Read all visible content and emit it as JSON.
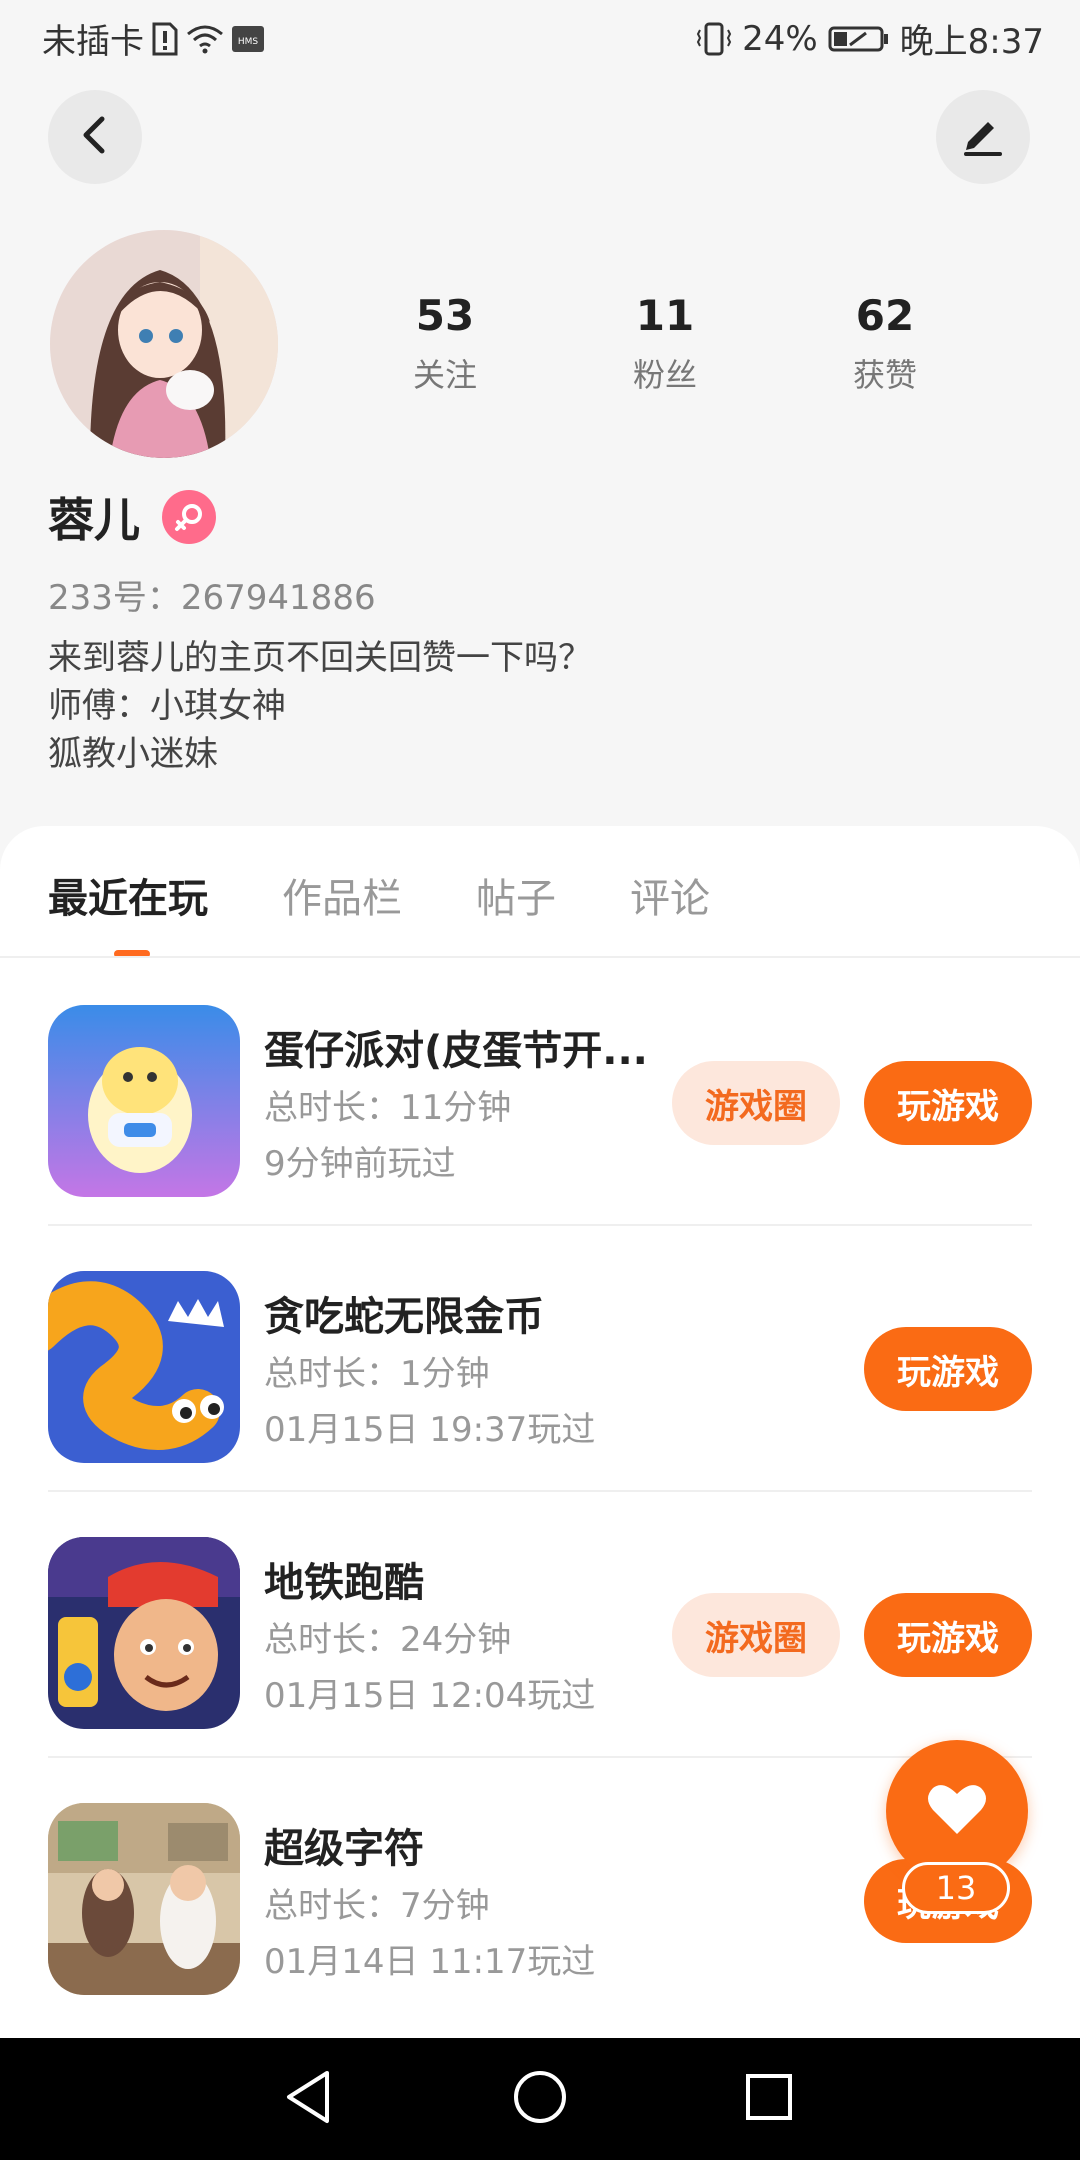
{
  "status_bar": {
    "carrier": "未插卡",
    "battery": "24%",
    "time": "晚上8:37"
  },
  "profile": {
    "name": "蓉儿",
    "uid_line": "233号：267941886",
    "bio": [
      "来到蓉儿的主页不回关回赞一下吗？",
      "师傅：小琪女神",
      "狐教小迷妹"
    ],
    "stats": [
      {
        "value": "53",
        "label": "关注"
      },
      {
        "value": "11",
        "label": "粉丝"
      },
      {
        "value": "62",
        "label": "获赞"
      }
    ]
  },
  "tabs": [
    "最近在玩",
    "作品栏",
    "帖子",
    "评论"
  ],
  "buttons": {
    "game_circle": "游戏圈",
    "play": "玩游戏"
  },
  "games": [
    {
      "title": "蛋仔派对(皮蛋节开...",
      "duration": "总时长：11分钟",
      "last_played": "9分钟前玩过",
      "has_circle": true
    },
    {
      "title": "贪吃蛇无限金币",
      "duration": "总时长：1分钟",
      "last_played": "01月15日 19:37玩过",
      "has_circle": false
    },
    {
      "title": "地铁跑酷",
      "duration": "总时长：24分钟",
      "last_played": "01月15日 12:04玩过",
      "has_circle": true
    },
    {
      "title": "超级字符",
      "duration": "总时长：7分钟",
      "last_played": "01月14日 11:17玩过",
      "has_circle": false
    }
  ],
  "like_fab": {
    "count": "13"
  },
  "colors": {
    "accent": "#fa6b14",
    "accent_light": "#fde7dc",
    "gender": "#ff6b8b"
  }
}
